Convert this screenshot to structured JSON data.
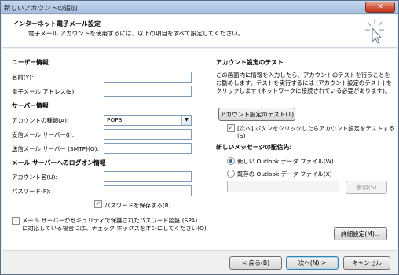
{
  "window": {
    "title": "新しいアカウントの追加",
    "close_glyph": "✕"
  },
  "header": {
    "title": "インターネット電子メール設定",
    "subtitle": "電子メール アカウントを使用するには、以下の項目をすべて設定してください。"
  },
  "user_info": {
    "heading": "ユーザー情報",
    "name_label": "名前(Y):",
    "name_value": "",
    "email_label": "電子メール アドレス(E):",
    "email_value": ""
  },
  "server_info": {
    "heading": "サーバー情報",
    "account_type_label": "アカウントの種類(A):",
    "account_type_value": "POP3",
    "incoming_label": "受信メール サーバー(I):",
    "incoming_value": "",
    "outgoing_label": "送信メール サーバー (SMTP)(O):",
    "outgoing_value": ""
  },
  "logon_info": {
    "heading": "メール サーバーへのログオン情報",
    "account_name_label": "アカウント名(U):",
    "account_name_value": "",
    "password_label": "パスワード(P):",
    "password_value": "",
    "remember_password_label": "パスワードを保存する(R)",
    "remember_password_checked": true,
    "spa_line1": "メール サーバーがセキュリティで保護されたパスワード認証 (SPA)",
    "spa_line2": "に対応している場合には、チェック ボックスをオンにしてください(Q)",
    "spa_checked": false
  },
  "test_settings": {
    "heading": "アカウント設定のテスト",
    "desc_line1": "この画面内に情報を入力したら、アカウントのテストを行うことを",
    "desc_line2": "お勧めします。テストを実行するには [アカウント設定のテスト] を",
    "desc_line3": "クリックします (ネットワークに接続されている必要があります)。",
    "test_button": "アカウント設定のテスト(T)",
    "auto_test_line1": "[次へ] ボタンをクリックしたらアカウント設定をテストする",
    "auto_test_line2": "(S)",
    "auto_test_checked": true
  },
  "delivery": {
    "heading": "新しいメッセージの配信先:",
    "option_new": "新しい Outlook データ ファイル(W)",
    "option_existing": "既存の Outlook データ ファイル(X)",
    "selected": "new",
    "path_value": "",
    "browse_button": "参照(S)"
  },
  "more_settings_button": "詳細設定(M)...",
  "footer": {
    "back_button": "< 戻る(B)",
    "next_button": "次へ(N) >",
    "cancel_button": "キャンセル"
  },
  "colors": {
    "title_gradient": "#b5c9e6",
    "close_red": "#c0361d",
    "check_blue": "#1b5a8a"
  },
  "icons": {
    "wizard": "cursor-sparkle-icon",
    "dropdown": "chevron-down-icon",
    "check": "checkmark-icon"
  }
}
